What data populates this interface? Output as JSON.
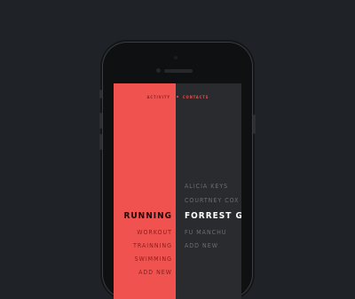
{
  "tabs": {
    "left": "ACTIVITY",
    "right": "CONTACTS"
  },
  "activities": {
    "selected": "RUNNING",
    "items": [
      "WORKOUT",
      "TRAINNING",
      "SWIMMING",
      "ADD NEW"
    ]
  },
  "contacts": {
    "above": [
      "ALICIA KEYS",
      "COURTNEY COX"
    ],
    "selected": "FORREST G.",
    "below": [
      "FU MANCHU",
      "ADD NEW"
    ]
  },
  "colors": {
    "accent": "#f0534f",
    "dark_panel": "#2a2b2e",
    "background": "#1f2226"
  }
}
